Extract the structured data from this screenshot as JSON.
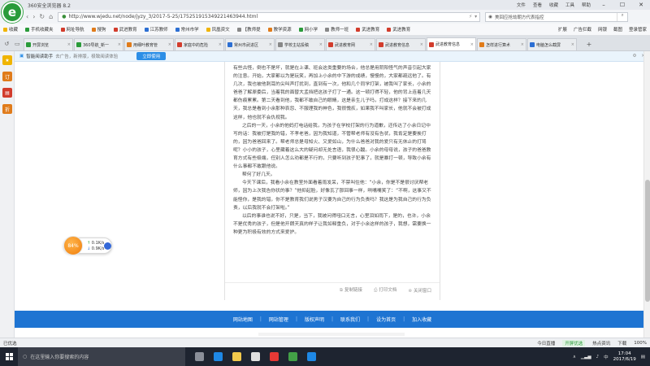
{
  "window": {
    "title": "360安全浏览器 8.2",
    "menu": [
      "文件",
      "查看",
      "收藏",
      "工具",
      "帮助"
    ]
  },
  "address_bar": {
    "url": "http://www.wjedu.net/node/jyzy_3/2017-5-25/175251915349221463944.html",
    "search_placeholder": "美回应抢劫朝方代表指控"
  },
  "favorites": {
    "label": "收藏",
    "items": [
      "手机收藏夹",
      "网址导航",
      "搜狗",
      "武进教育",
      "江苏教师",
      "常州市学",
      "凤凰资文",
      "【教师提",
      "教学资源",
      "网小学",
      "教师一班",
      "武进教育",
      "武进教育"
    ],
    "right": [
      "扩展",
      "广告拦截",
      "网银",
      "截图",
      "登录管家"
    ]
  },
  "tabs": [
    {
      "label": "开屏浏览",
      "color": "#2a9b3a"
    },
    {
      "label": "360导航_新一",
      "color": "#2a9b3a"
    },
    {
      "label": "用细叶教育管",
      "color": "#e07b1a"
    },
    {
      "label": "家庭中的危险",
      "color": "#d23c2c"
    },
    {
      "label": "常州市武进区",
      "color": "#2c6fd3"
    },
    {
      "label": "学校主站投稿",
      "color": "#888888"
    },
    {
      "label": "武进教育网",
      "color": "#d23c2c"
    },
    {
      "label": "武进教育信息",
      "color": "#d23c2c"
    },
    {
      "label": "武进教育信息",
      "color": "#d23c2c",
      "active": true
    },
    {
      "label": "怎样进行算术",
      "color": "#e07b1a"
    },
    {
      "label": "电脑怎么截屏",
      "color": "#2c6fd3"
    }
  ],
  "infobar": {
    "title": "智能阅读助手",
    "hint": "去广告，新排版，极致阅读体验",
    "button": "立即使用"
  },
  "article": {
    "paragraphs": [
      "有些古怪，倒也不是坏，就是在上课、班会这类重要的场合，他总是用阴阳怪气的声音引起大家的注意。开始，大家都以为是玩笑，再加上小余的中下游的成绩，慢慢的，大家都疏远他了。有几次，我也被他刺耳的尖叫声打扰到，直到有一次，他和几个同学打架，被我叫了家长，小余的爸爸了解原委后，当着我的面替大孟挡把这孩子打了一通。这一顿打得不轻，他的背上连着几天都伤痕累累。第二天看到他，我都不敢自己的眼睛，这是亲生儿子吗，打成这样？接下来的几天，我总是看到小余那种哀怨、不服理我的神色，我很愧疚，如果我不叫家长，他就不会被打成这样，他也就不会仇视我。",
      "之后的一天，小余的他妈打电话给我，为孩子在学校打架的行为道歉，还传达了小余日记中写的话：我被打是我的错，不孝老爸，因为我知道，不管帮老师有没有告状，我肯定是要挨打的，因为爸爸回来了。帮老师总是母知火、又爱如山，为什么爸爸对我的爱只有无休止的打骂呢？小小的孩子，心里藏着这么大的疑问却无处言语，我很心酸。小余的母母说，孩子的爸爸教育方式有些极端，任别人怎么劝都是不行的，只要听到孩子犯事了，就是暴打一顿，导致小余有什么事都不敢跟他说。",
      "帮何了好几天。",
      "今天下课后，我看小余在教室外面看着雨发呆，不禁叫住他：“小余，你是不是很讨厌帮老师，因为上次我告你状的事？”他抑起脸，好像瓦了那回事一样，咧嘴嘴笑了：“不啊，这事又不能怪你，是我的错，你不是教育我们说男子汉要为自己的行为负责吗？我这是为我自己的行为负责，以后我就不会打架啦。”",
      "以后的事谁也说不好，只是，当下，我被问得哑口无言，心里泪如雨下，是的，也许，小余不是优秀的孩子，但是他开朗天真的样子让我如释重负，对于小余这样的孩子，我想，需要换一种更为积极有效的方式来爱护。"
    ],
    "actions": [
      "复制链接",
      "打印文档",
      "关闭窗口"
    ]
  },
  "footer": {
    "links": [
      "网站地图",
      "网站管理",
      "版权声明",
      "联系我们",
      "设为首页",
      "加入收藏"
    ]
  },
  "net_widget": {
    "percent": "84%",
    "upload": "0.1K/s",
    "download": "0.9K/s"
  },
  "statusbar": {
    "left": "已优选",
    "right": [
      "今日直播",
      "开屏优选",
      "热点资讯",
      "下载",
      "100%"
    ]
  },
  "taskbar": {
    "search_placeholder": "在这里输入你要搜索的内容",
    "time": "17:04",
    "date": "2017/6/19",
    "lang": "中"
  }
}
